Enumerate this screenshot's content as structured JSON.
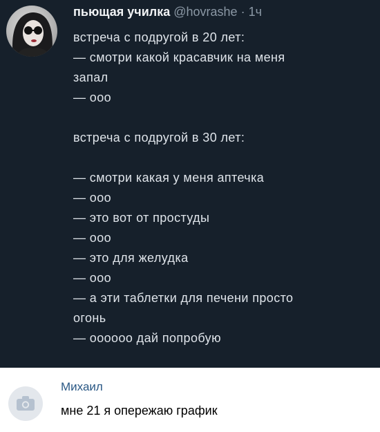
{
  "tweet": {
    "author_name": "пьющая училка",
    "handle": "@hovrashe",
    "separator": " · ",
    "time": "1ч",
    "lines": [
      "встреча с подругой в 20 лет:",
      "— смотри какой красавчик на меня",
      "запал",
      "— ооо",
      "",
      "встреча с подругой в 30 лет:",
      "",
      "— смотри какая у меня аптечка",
      "— ооо",
      "— это вот от простуды",
      "— ооо",
      "— это для желудка",
      "— ооо",
      "— а эти таблетки для печени просто",
      "огонь",
      "— оооооо дай попробую"
    ]
  },
  "comment": {
    "author": "Михаил",
    "text": "мне 21 я опережаю график",
    "avatar_icon": "camera-icon"
  },
  "colors": {
    "tweet_bg": "#16202b",
    "link": "#2a5885"
  }
}
